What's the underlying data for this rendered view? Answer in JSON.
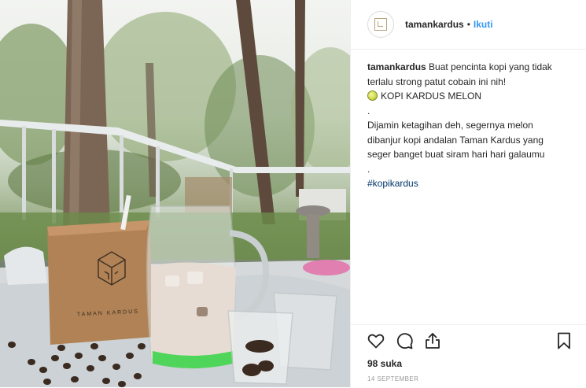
{
  "post": {
    "photo_alt": "TAMAN KARDUS",
    "brand_mark_text": "TAMAN KARDUS"
  },
  "header": {
    "avatar_text": "TAMAN KARDUS",
    "username": "tamankardus",
    "separator": "•",
    "follow_label": "Ikuti"
  },
  "caption": {
    "username": "tamankardus",
    "line1": " Buat pencinta kopi yang tidak",
    "line2": "terlalu strong patut cobain ini nih!",
    "line3": "KOPI KARDUS MELON",
    "line4": ".",
    "line5": "Dijamin ketagihan deh, segernya melon",
    "line6": "dibanjur kopi andalan Taman Kardus yang",
    "line7": "seger banget buat siram hari hari galaumu",
    "line8": ".",
    "hashtag": "#kopikardus"
  },
  "actions": {
    "like_icon": "heart-icon",
    "comment_icon": "comment-icon",
    "share_icon": "share-icon",
    "save_icon": "bookmark-icon",
    "likes": "98 suka",
    "date": "14 SEPTEMBER"
  }
}
